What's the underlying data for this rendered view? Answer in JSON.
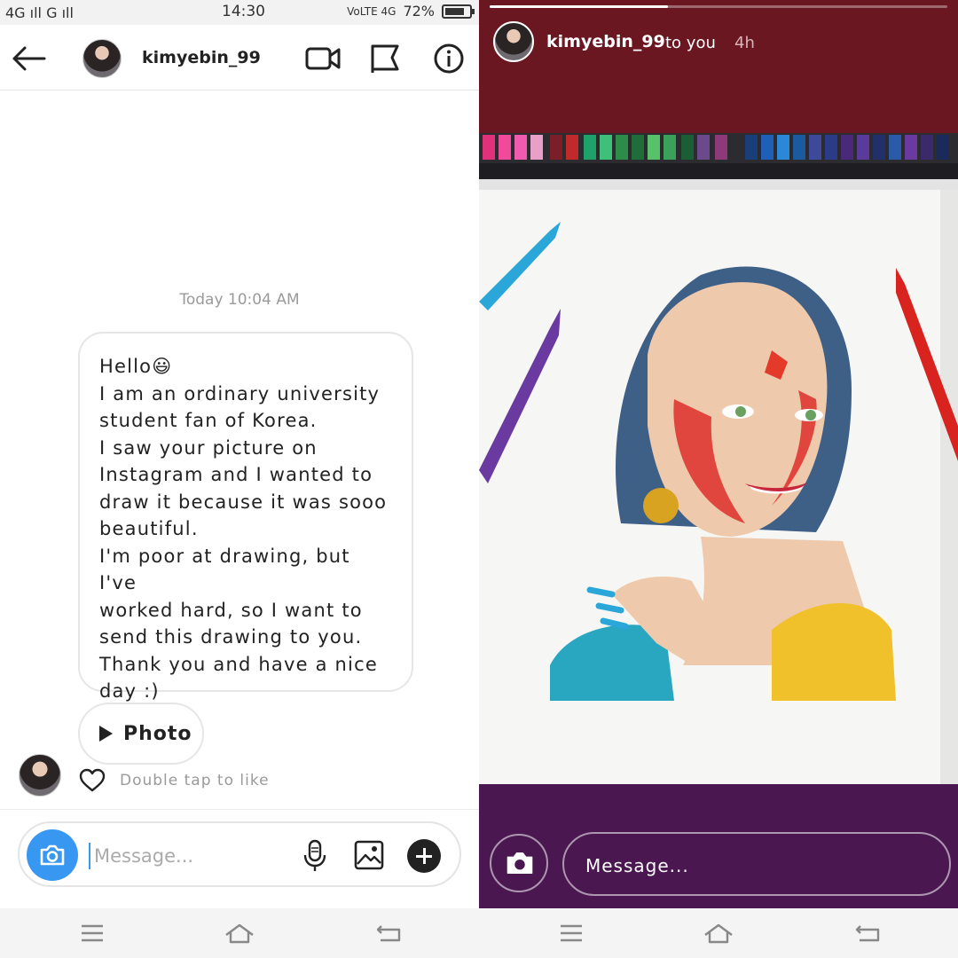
{
  "status_bar": {
    "left": "4G ıll G ıll",
    "time": "14:30",
    "network": "VoLTE 4G",
    "battery": "72%"
  },
  "dm": {
    "username": "kimyebin_99",
    "timestamp": "Today 10:04 AM",
    "message": "Hello😃\nI am an ordinary university\nstudent fan of Korea.\nI saw your picture on\nInstagram and I wanted to\ndraw it because it was sooo\nbeautiful.\nI'm poor at drawing, but I've\nworked hard, so I want to\nsend this drawing to you.\nThank you and have a nice\nday :)",
    "photo_label": "Photo",
    "like_hint": "Double tap to like",
    "composer_placeholder": "Message..."
  },
  "story": {
    "username": "kimyebin_99",
    "meta": "to you",
    "age": "4h",
    "progress": 0.39,
    "reply_placeholder": "Message..."
  },
  "icons": [
    "back-arrow-icon",
    "video-call-icon",
    "flag-icon",
    "info-icon",
    "play-icon",
    "heart-icon",
    "camera-icon",
    "microphone-icon",
    "gallery-icon",
    "plus-icon",
    "menu-icon",
    "home-icon",
    "back-nav-icon"
  ],
  "colors": {
    "accent": "#3897f0",
    "story_top": "#6b1722",
    "story_bottom": "#4b1751"
  }
}
